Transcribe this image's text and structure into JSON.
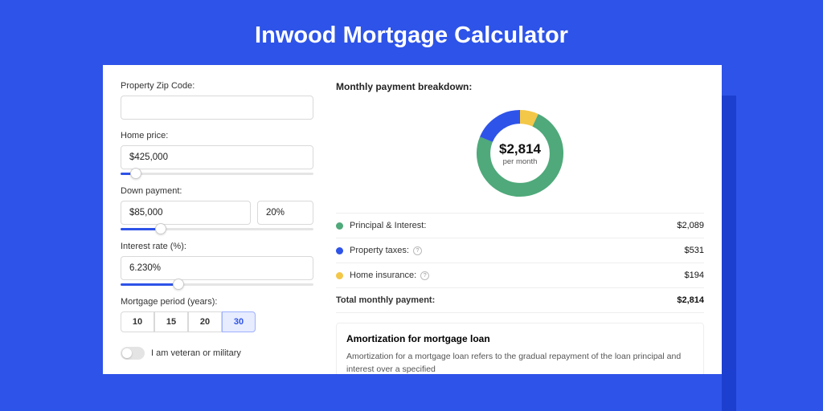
{
  "title": "Inwood Mortgage Calculator",
  "form": {
    "zip": {
      "label": "Property Zip Code:",
      "value": ""
    },
    "homePrice": {
      "label": "Home price:",
      "value": "$425,000",
      "sliderPct": 8
    },
    "downPayment": {
      "label": "Down payment:",
      "amount": "$85,000",
      "percent": "20%",
      "sliderPct": 21
    },
    "interest": {
      "label": "Interest rate (%):",
      "value": "6.230%",
      "sliderPct": 30
    },
    "period": {
      "label": "Mortgage period (years):",
      "options": [
        "10",
        "15",
        "20",
        "30"
      ],
      "selected": "30"
    },
    "veteran": {
      "label": "I am veteran or military",
      "checked": false
    }
  },
  "breakdown": {
    "title": "Monthly payment breakdown:",
    "centerAmount": "$2,814",
    "centerSub": "per month",
    "rows": [
      {
        "label": "Principal & Interest:",
        "value": "$2,089",
        "color": "#4fa97a",
        "info": false
      },
      {
        "label": "Property taxes:",
        "value": "$531",
        "color": "#2e53e8",
        "info": true
      },
      {
        "label": "Home insurance:",
        "value": "$194",
        "color": "#f3c748",
        "info": true
      }
    ],
    "total": {
      "label": "Total monthly payment:",
      "value": "$2,814"
    }
  },
  "amort": {
    "title": "Amortization for mortgage loan",
    "text": "Amortization for a mortgage loan refers to the gradual repayment of the loan principal and interest over a specified"
  },
  "chart_data": {
    "type": "pie",
    "title": "Monthly payment breakdown",
    "series": [
      {
        "name": "Principal & Interest",
        "value": 2089,
        "color": "#4fa97a"
      },
      {
        "name": "Property taxes",
        "value": 531,
        "color": "#2e53e8"
      },
      {
        "name": "Home insurance",
        "value": 194,
        "color": "#f3c748"
      }
    ],
    "total": 2814
  }
}
